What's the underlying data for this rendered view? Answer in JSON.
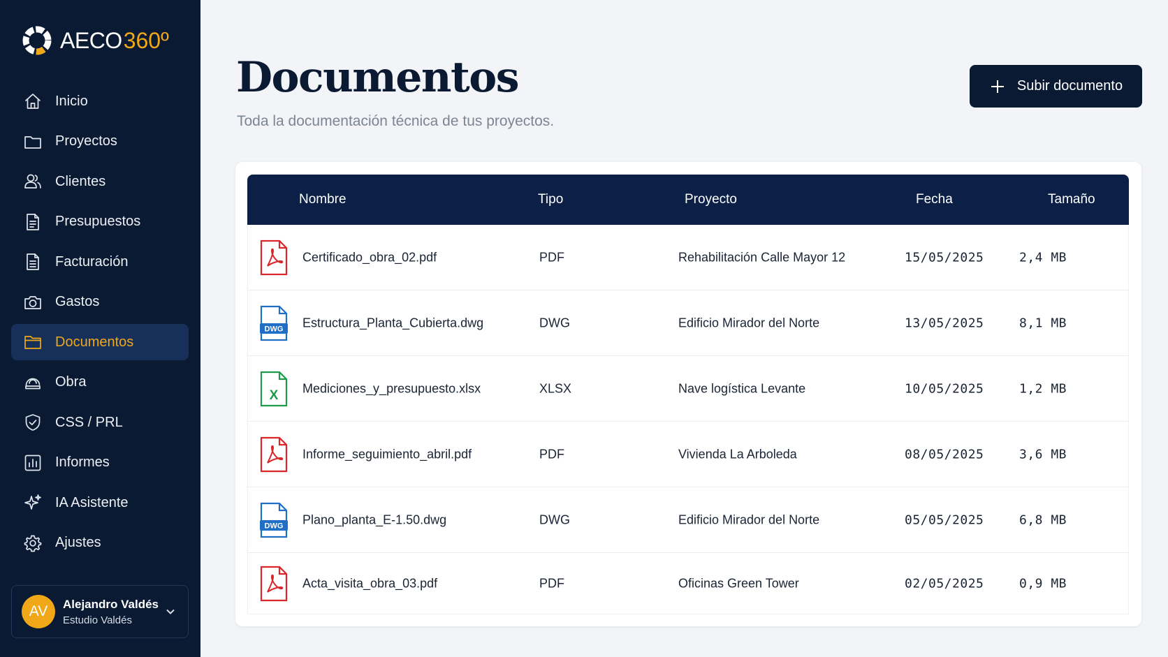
{
  "brand": {
    "name": "AECO",
    "accent": "360º",
    "accent_color": "#f0a818"
  },
  "sidebar": {
    "items": [
      {
        "label": "Inicio",
        "icon": "home-icon"
      },
      {
        "label": "Proyectos",
        "icon": "folder-icon"
      },
      {
        "label": "Clientes",
        "icon": "users-icon"
      },
      {
        "label": "Presupuestos",
        "icon": "document-icon"
      },
      {
        "label": "Facturación",
        "icon": "invoice-icon"
      },
      {
        "label": "Gastos",
        "icon": "camera-icon"
      },
      {
        "label": "Documentos",
        "icon": "folder-open-icon",
        "active": true
      },
      {
        "label": "Obra",
        "icon": "helmet-icon"
      },
      {
        "label": "CSS / PRL",
        "icon": "shield-check-icon"
      },
      {
        "label": "Informes",
        "icon": "bar-chart-icon"
      },
      {
        "label": "IA Asistente",
        "icon": "sparkles-icon"
      },
      {
        "label": "Ajustes",
        "icon": "gear-icon"
      }
    ],
    "user": {
      "initials": "AV",
      "name": "Alejandro Valdés",
      "org": "Estudio Valdés"
    }
  },
  "header": {
    "title": "Documentos",
    "subtitle": "Toda la documentación técnica de tus proyectos.",
    "upload_label": "Subir documento"
  },
  "table": {
    "columns": [
      "Nombre",
      "Tipo",
      "Proyecto",
      "Fecha",
      "Tamaño"
    ],
    "rows": [
      {
        "name": "Certificado_obra_02.pdf",
        "type": "PDF",
        "project": "Rehabilitación Calle Mayor 12",
        "date": "15/05/2025",
        "size": "2,4 MB",
        "icon": "pdf-file-icon"
      },
      {
        "name": "Estructura_Planta_Cubierta.dwg",
        "type": "DWG",
        "project": "Edificio Mirador del Norte",
        "date": "13/05/2025",
        "size": "8,1 MB",
        "icon": "dwg-file-icon"
      },
      {
        "name": "Mediciones_y_presupuesto.xlsx",
        "type": "XLSX",
        "project": "Nave logística Levante",
        "date": "10/05/2025",
        "size": "1,2 MB",
        "icon": "xlsx-file-icon"
      },
      {
        "name": "Informe_seguimiento_abril.pdf",
        "type": "PDF",
        "project": "Vivienda La Arboleda",
        "date": "08/05/2025",
        "size": "3,6 MB",
        "icon": "pdf-file-icon"
      },
      {
        "name": "Plano_planta_E-1.50.dwg",
        "type": "DWG",
        "project": "Edificio Mirador del Norte",
        "date": "05/05/2025",
        "size": "6,8 MB",
        "icon": "dwg-file-icon"
      },
      {
        "name": "Acta_visita_obra_03.pdf",
        "type": "PDF",
        "project": "Oficinas Green Tower",
        "date": "02/05/2025",
        "size": "0,9 MB",
        "icon": "pdf-file-icon"
      }
    ]
  },
  "file_labels": {
    "dwg": "DWG",
    "xlsx": "X"
  },
  "colors": {
    "sidebar_bg": "#0a1a33",
    "accent": "#f0a818",
    "table_header": "#0b1f47",
    "pdf": "#d8262a",
    "dwg": "#1f6fc7",
    "xlsx": "#1e9a4a"
  }
}
